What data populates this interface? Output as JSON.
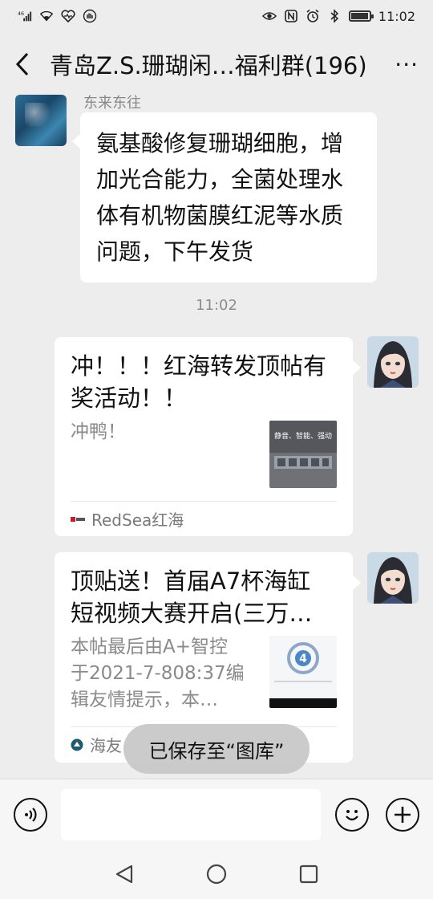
{
  "status_bar": {
    "signal_label": "46",
    "time": "11:02"
  },
  "header": {
    "title": "青岛Z.S.珊瑚闲…福利群(196)",
    "more_label": "···"
  },
  "messages": {
    "first": {
      "sender": "东来东往",
      "text": "氨基酸修复珊瑚细胞，增加光合能力，全菌处理水体有机物菌膜红泥等水质问题，下午发货"
    },
    "timestamp": "11:02",
    "card1": {
      "title_line1": "冲！！！红海转发顶帖有",
      "title_line2": "奖活动！！",
      "desc": "冲鸭！",
      "thumb_text": "静音、智能、强动",
      "source": "RedSea红海"
    },
    "card2": {
      "title_line1": "顶贴送！首届A7杯海缸",
      "title_line2": "短视频大赛开启(三万…",
      "desc_line1": "本帖最后由A+智控",
      "desc_line2": "于2021-7-808:37编",
      "desc_line3": "辑友情提示，本…",
      "source": "海友"
    }
  },
  "toast": "已保存至“图库”",
  "icons": {
    "back": "chevron-left-icon",
    "voice": "voice-icon",
    "emoji": "emoji-icon",
    "add": "plus-icon",
    "nav_back": "triangle-back-icon",
    "nav_home": "circle-home-icon",
    "nav_recent": "square-recent-icon"
  }
}
